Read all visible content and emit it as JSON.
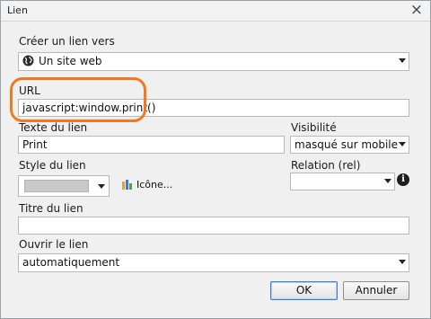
{
  "window": {
    "title": "Lien",
    "close_glyph": "×"
  },
  "link_type": {
    "label": "Créer un lien vers",
    "value": "Un site web",
    "icon": "globe-icon"
  },
  "url": {
    "label": "URL",
    "value": "javascript:window.print()"
  },
  "link_text": {
    "label": "Texte du lien",
    "value": "Print"
  },
  "visibility": {
    "label": "Visibilité",
    "value": "masqué sur mobile"
  },
  "link_style": {
    "label": "Style du lien",
    "swatch_color": "#c9c9c9",
    "icon_button_label": "Icône..."
  },
  "relation": {
    "label": "Relation (rel)",
    "value": "",
    "info_glyph": "i"
  },
  "link_title": {
    "label": "Titre du lien",
    "value": ""
  },
  "open_link": {
    "label": "Ouvrir le lien",
    "value": "automatiquement"
  },
  "buttons": {
    "ok": "OK",
    "cancel": "Annuler"
  },
  "colors": {
    "highlight": "#f2771e",
    "primary_border": "#3d7bd9"
  }
}
